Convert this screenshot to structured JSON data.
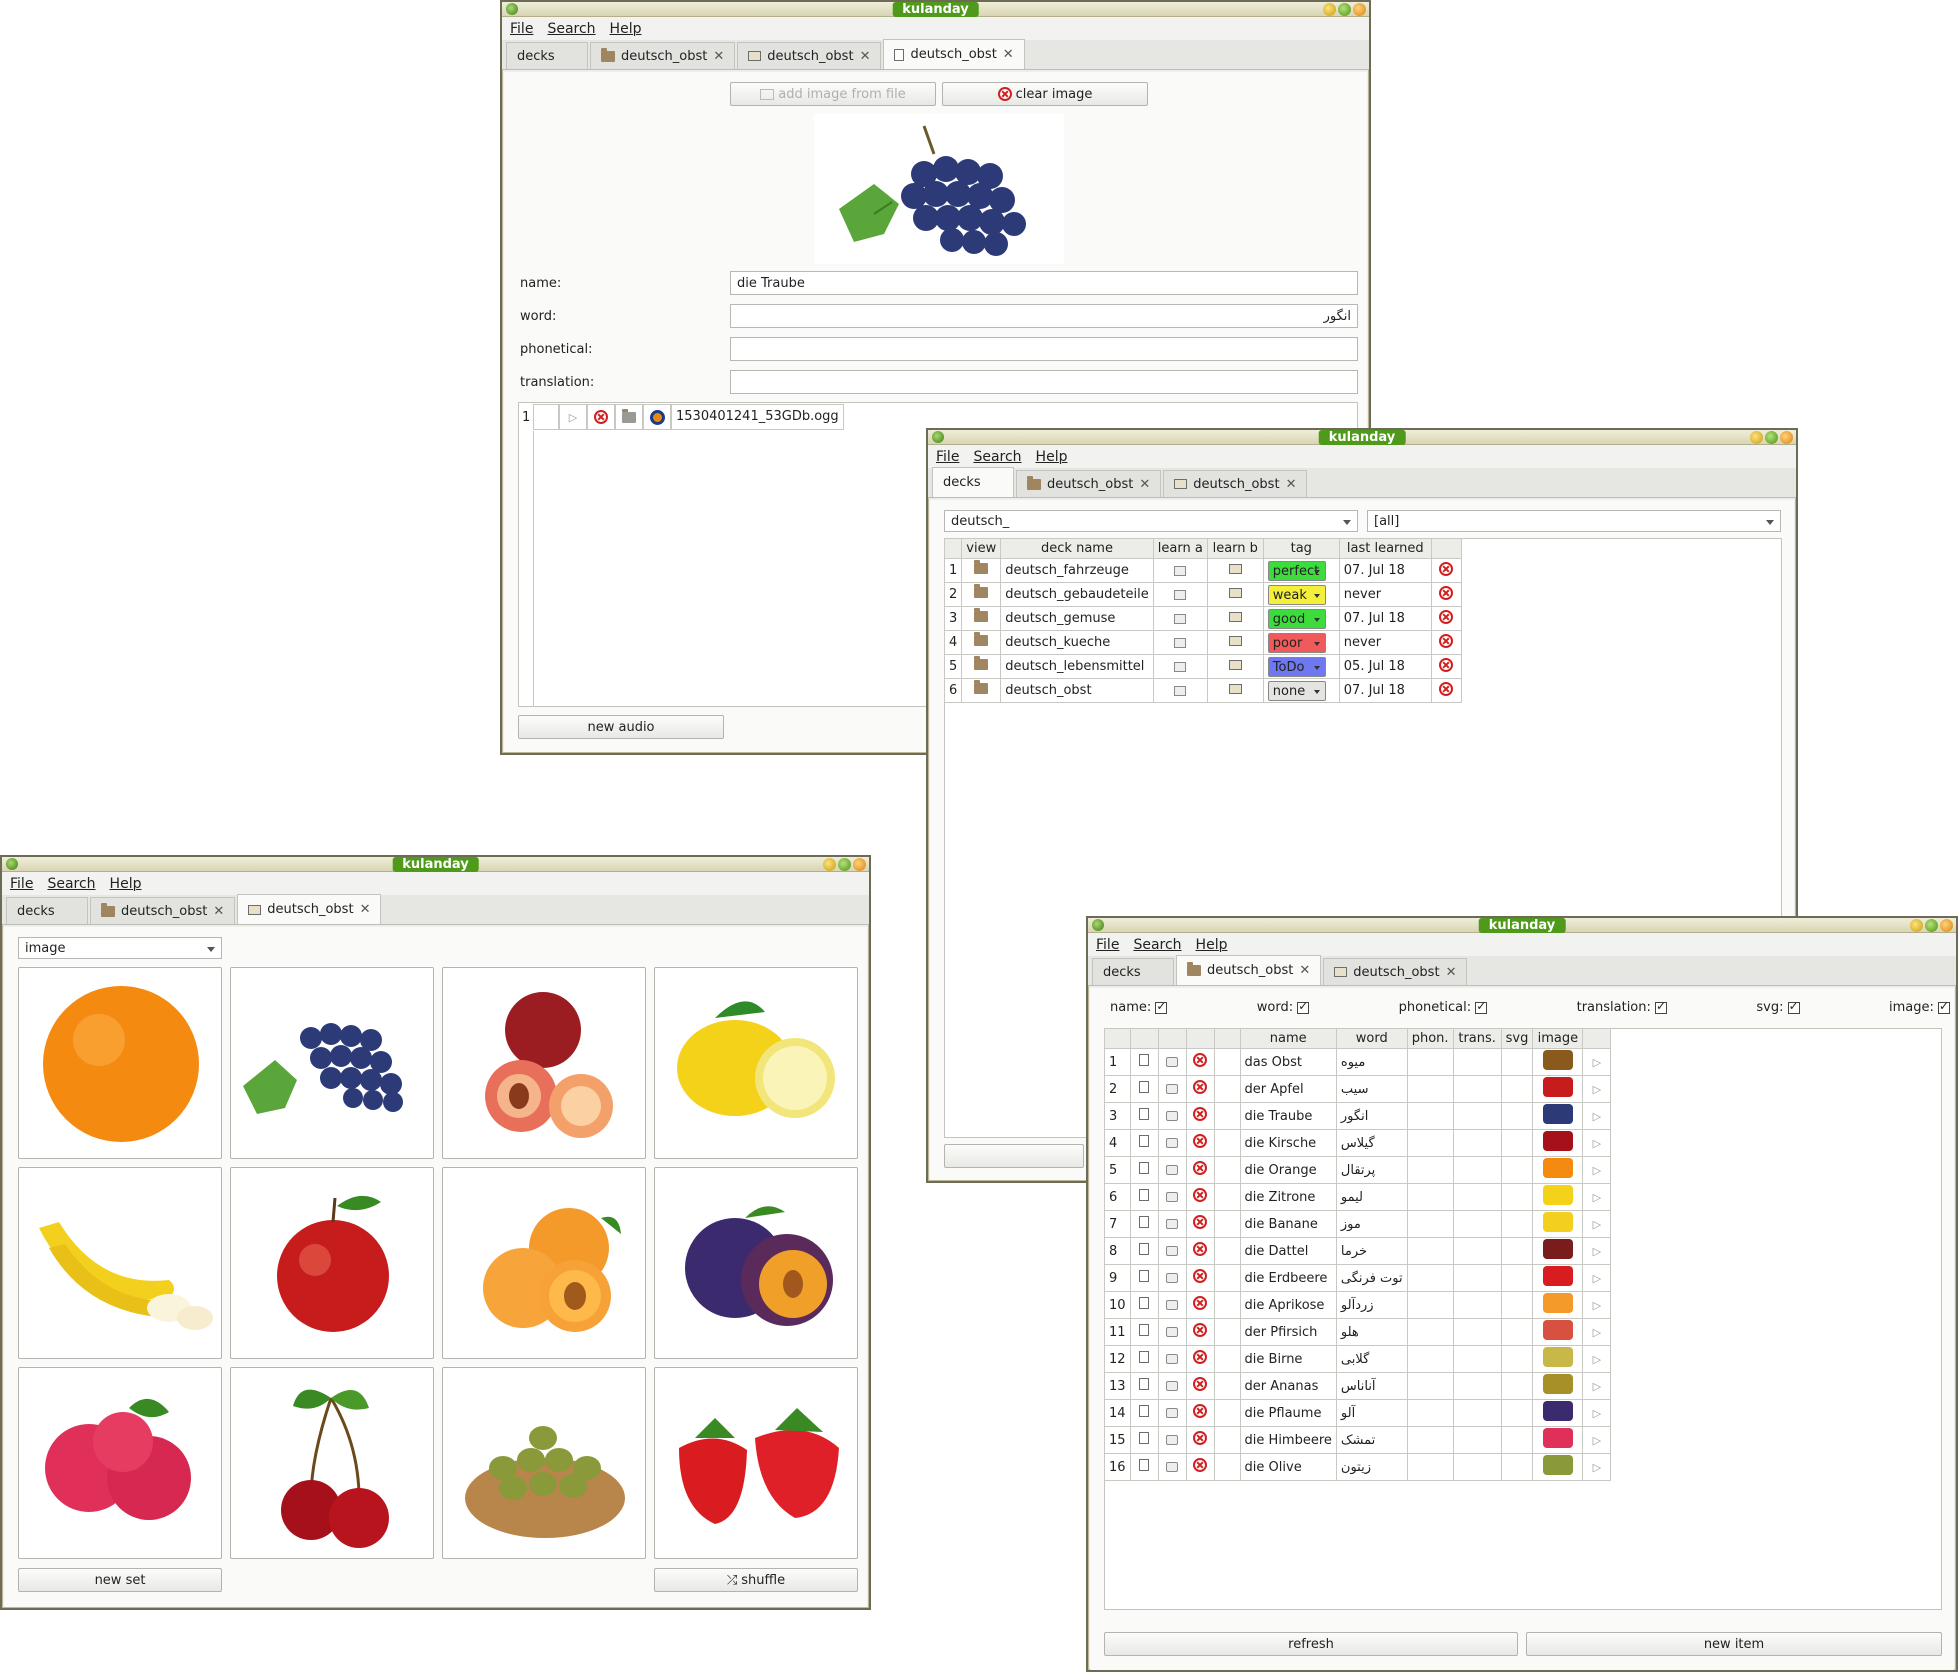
{
  "app": {
    "title": "kulanday",
    "menu": [
      "File",
      "Search",
      "Help"
    ]
  },
  "win1": {
    "tabs": [
      {
        "label": "decks"
      },
      {
        "label": "deutsch_obst",
        "close": "✕"
      },
      {
        "label": "deutsch_obst",
        "close": "✕"
      },
      {
        "label": "deutsch_obst",
        "close": "✕"
      }
    ],
    "add_image_label": "add image from file",
    "clear_image_label": "clear image",
    "fields": [
      {
        "label": "name:",
        "value": "die Traube"
      },
      {
        "label": "word:",
        "value": "انگور"
      },
      {
        "label": "phonetical:",
        "value": ""
      },
      {
        "label": "translation:",
        "value": ""
      }
    ],
    "audio_row": {
      "index": "1",
      "file": "1530401241_53GDb.ogg"
    },
    "new_audio_label": "new audio"
  },
  "win2": {
    "tabs": [
      {
        "label": "decks"
      },
      {
        "label": "deutsch_obst",
        "close": "✕"
      },
      {
        "label": "deutsch_obst",
        "close": "✕"
      }
    ],
    "filter_text": "deutsch_",
    "filter_tag": "[all]",
    "headers": [
      "view",
      "deck name",
      "learn a",
      "learn b",
      "tag",
      "last learned"
    ],
    "rows": [
      {
        "n": "1",
        "name": "deutsch_fahrzeuge",
        "tag": "perfect",
        "tag_color": "#3ddc3d",
        "last": "07. Jul 18"
      },
      {
        "n": "2",
        "name": "deutsch_gebaudeteile",
        "tag": "weak",
        "tag_color": "#f4ef3a",
        "last": "never"
      },
      {
        "n": "3",
        "name": "deutsch_gemuse",
        "tag": "good",
        "tag_color": "#3ddc3d",
        "last": "07. Jul 18"
      },
      {
        "n": "4",
        "name": "deutsch_kueche",
        "tag": "poor",
        "tag_color": "#f05a5a",
        "last": "never"
      },
      {
        "n": "5",
        "name": "deutsch_lebensmittel",
        "tag": "ToDo",
        "tag_color": "#6e78f0",
        "last": "05. Jul 18"
      },
      {
        "n": "6",
        "name": "deutsch_obst",
        "tag": "none",
        "tag_color": "#e4e4e1",
        "last": "07. Jul 18"
      }
    ]
  },
  "win3": {
    "tabs": [
      {
        "label": "decks"
      },
      {
        "label": "deutsch_obst",
        "close": "✕"
      },
      {
        "label": "deutsch_obst",
        "close": "✕"
      }
    ],
    "mode": "image",
    "new_set_label": "new set",
    "shuffle_label": "shuffle"
  },
  "win4": {
    "tabs": [
      {
        "label": "decks"
      },
      {
        "label": "deutsch_obst",
        "close": "✕"
      },
      {
        "label": "deutsch_obst",
        "close": "✕"
      }
    ],
    "checks": [
      "name:",
      "word:",
      "phonetical:",
      "translation:",
      "svg:",
      "image:"
    ],
    "headers": [
      "name",
      "word",
      "phon.",
      "trans.",
      "svg",
      "image"
    ],
    "rows": [
      {
        "n": "1",
        "name": "das Obst",
        "word": "میوه"
      },
      {
        "n": "2",
        "name": "der Apfel",
        "word": "سیب"
      },
      {
        "n": "3",
        "name": "die Traube",
        "word": "انگور"
      },
      {
        "n": "4",
        "name": "die Kirsche",
        "word": "گیلاس"
      },
      {
        "n": "5",
        "name": "die Orange",
        "word": "پرتقال"
      },
      {
        "n": "6",
        "name": "die Zitrone",
        "word": "لیمو"
      },
      {
        "n": "7",
        "name": "die Banane",
        "word": "موز"
      },
      {
        "n": "8",
        "name": "die Dattel",
        "word": "خرما"
      },
      {
        "n": "9",
        "name": "die Erdbeere",
        "word": "توت فرنگی"
      },
      {
        "n": "10",
        "name": "die Aprikose",
        "word": "زردآلو"
      },
      {
        "n": "11",
        "name": "der Pfirsich",
        "word": "هلو"
      },
      {
        "n": "12",
        "name": "die Birne",
        "word": "گلابی"
      },
      {
        "n": "13",
        "name": "der Ananas",
        "word": "آناناس"
      },
      {
        "n": "14",
        "name": "die Pflaume",
        "word": "آلو"
      },
      {
        "n": "15",
        "name": "die Himbeere",
        "word": "تمشک"
      },
      {
        "n": "16",
        "name": "die Olive",
        "word": "زیتون"
      }
    ],
    "refresh_label": "refresh",
    "new_item_label": "new item"
  }
}
